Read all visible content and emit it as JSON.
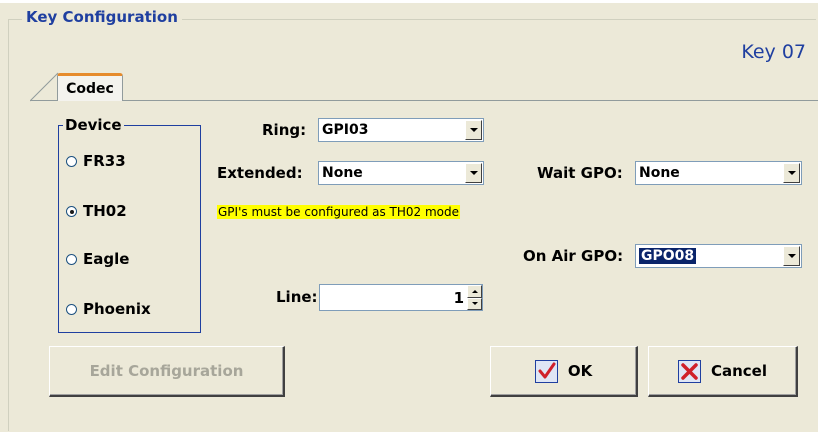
{
  "group": {
    "title": "Key Configuration"
  },
  "key_label": "Key 07",
  "tabs": [
    {
      "label": "Codec",
      "active": true
    }
  ],
  "device": {
    "legend": "Device",
    "options": [
      {
        "label": "FR33",
        "checked": false
      },
      {
        "label": "TH02",
        "checked": true
      },
      {
        "label": "Eagle",
        "checked": false
      },
      {
        "label": "Phoenix",
        "checked": false
      }
    ]
  },
  "fields": {
    "ring": {
      "label": "Ring:",
      "value": "GPI03"
    },
    "extended": {
      "label": "Extended:",
      "value": "None"
    },
    "wait_gpo": {
      "label": "Wait GPO:",
      "value": "None"
    },
    "on_air_gpo": {
      "label": "On Air GPO:",
      "value": "GPO08"
    },
    "line": {
      "label": "Line:",
      "value": "1"
    }
  },
  "warning": "GPI's must be configured as TH02 mode",
  "buttons": {
    "edit": "Edit Configuration",
    "ok": "OK",
    "cancel": "Cancel"
  },
  "icons": {
    "ok": "checkmark-icon",
    "cancel": "red-x-icon"
  },
  "colors": {
    "accent": "#1f3fa0",
    "warning_bg": "#ffff00",
    "selection": "#0a246a",
    "panel_bg": "#ece9d8"
  }
}
